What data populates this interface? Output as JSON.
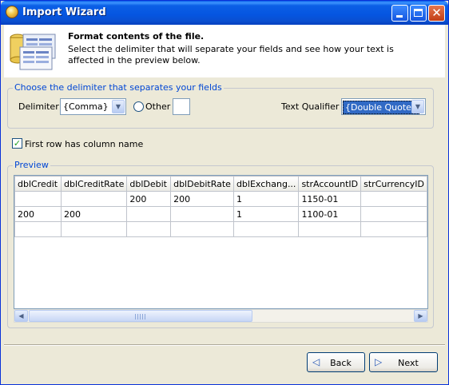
{
  "window": {
    "title": "Import Wizard",
    "controls": {
      "minimize": "minimize",
      "maximize": "maximize",
      "close": "✕"
    }
  },
  "header": {
    "title": "Format contents of the file.",
    "description": "Select the delimiter that will separate your fields and see how your text is affected in the preview below."
  },
  "delimiter_group": {
    "legend": "Choose the delimiter that separates your fields",
    "delimiter_label": "Delimiter",
    "delimiter_value": "{Comma}",
    "other_label": "Other",
    "other_value": "",
    "qualifier_label": "Text Qualifier",
    "qualifier_value": "{Double Quote}"
  },
  "first_row": {
    "label": "First row has column name",
    "checked": true
  },
  "preview": {
    "legend": "Preview",
    "columns": [
      "dblCredit",
      "dblCreditRate",
      "dblDebit",
      "dblDebitRate",
      "dblExchang...",
      "strAccountID",
      "strCurrencyID"
    ],
    "rows": [
      [
        "",
        "",
        "200",
        "200",
        "1",
        "1150-01",
        ""
      ],
      [
        "200",
        "200",
        "",
        "",
        "1",
        "1100-01",
        ""
      ],
      [
        "",
        "",
        "",
        "",
        "",
        "",
        ""
      ]
    ]
  },
  "buttons": {
    "back": "Back",
    "next": "Next"
  }
}
